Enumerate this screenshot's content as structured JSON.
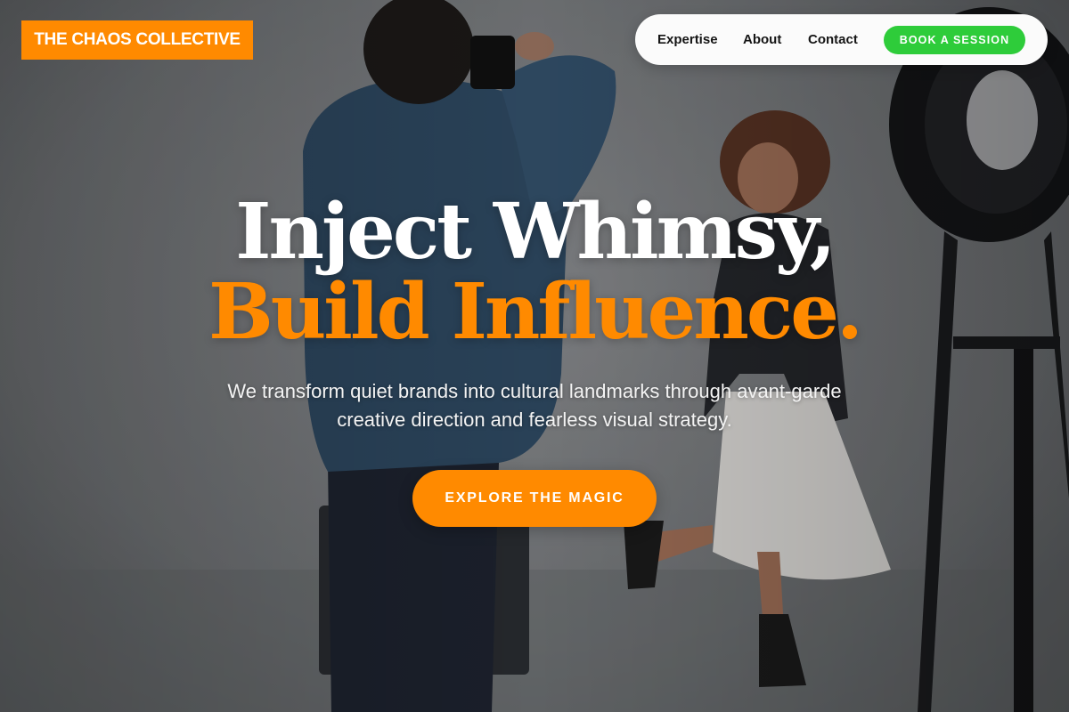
{
  "brand": {
    "name": "THE CHAOS COLLECTIVE"
  },
  "nav": {
    "links": [
      "Expertise",
      "About",
      "Contact"
    ],
    "cta_label": "BOOK A SESSION"
  },
  "hero": {
    "title_line1": "Inject Whimsy,",
    "title_line2": "Build Influence.",
    "subtitle": "We transform quiet brands into cultural landmarks through avant-garde creative direction and fearless visual strategy.",
    "cta_label": "EXPLORE THE MAGIC"
  },
  "colors": {
    "accent_orange": "#ff8a00",
    "cta_green": "#2ecc3a",
    "nav_background": "#fbfbfb",
    "hero_text": "#ffffff"
  },
  "icons": [
    "photographer-image",
    "model-image",
    "studio-light-image"
  ]
}
